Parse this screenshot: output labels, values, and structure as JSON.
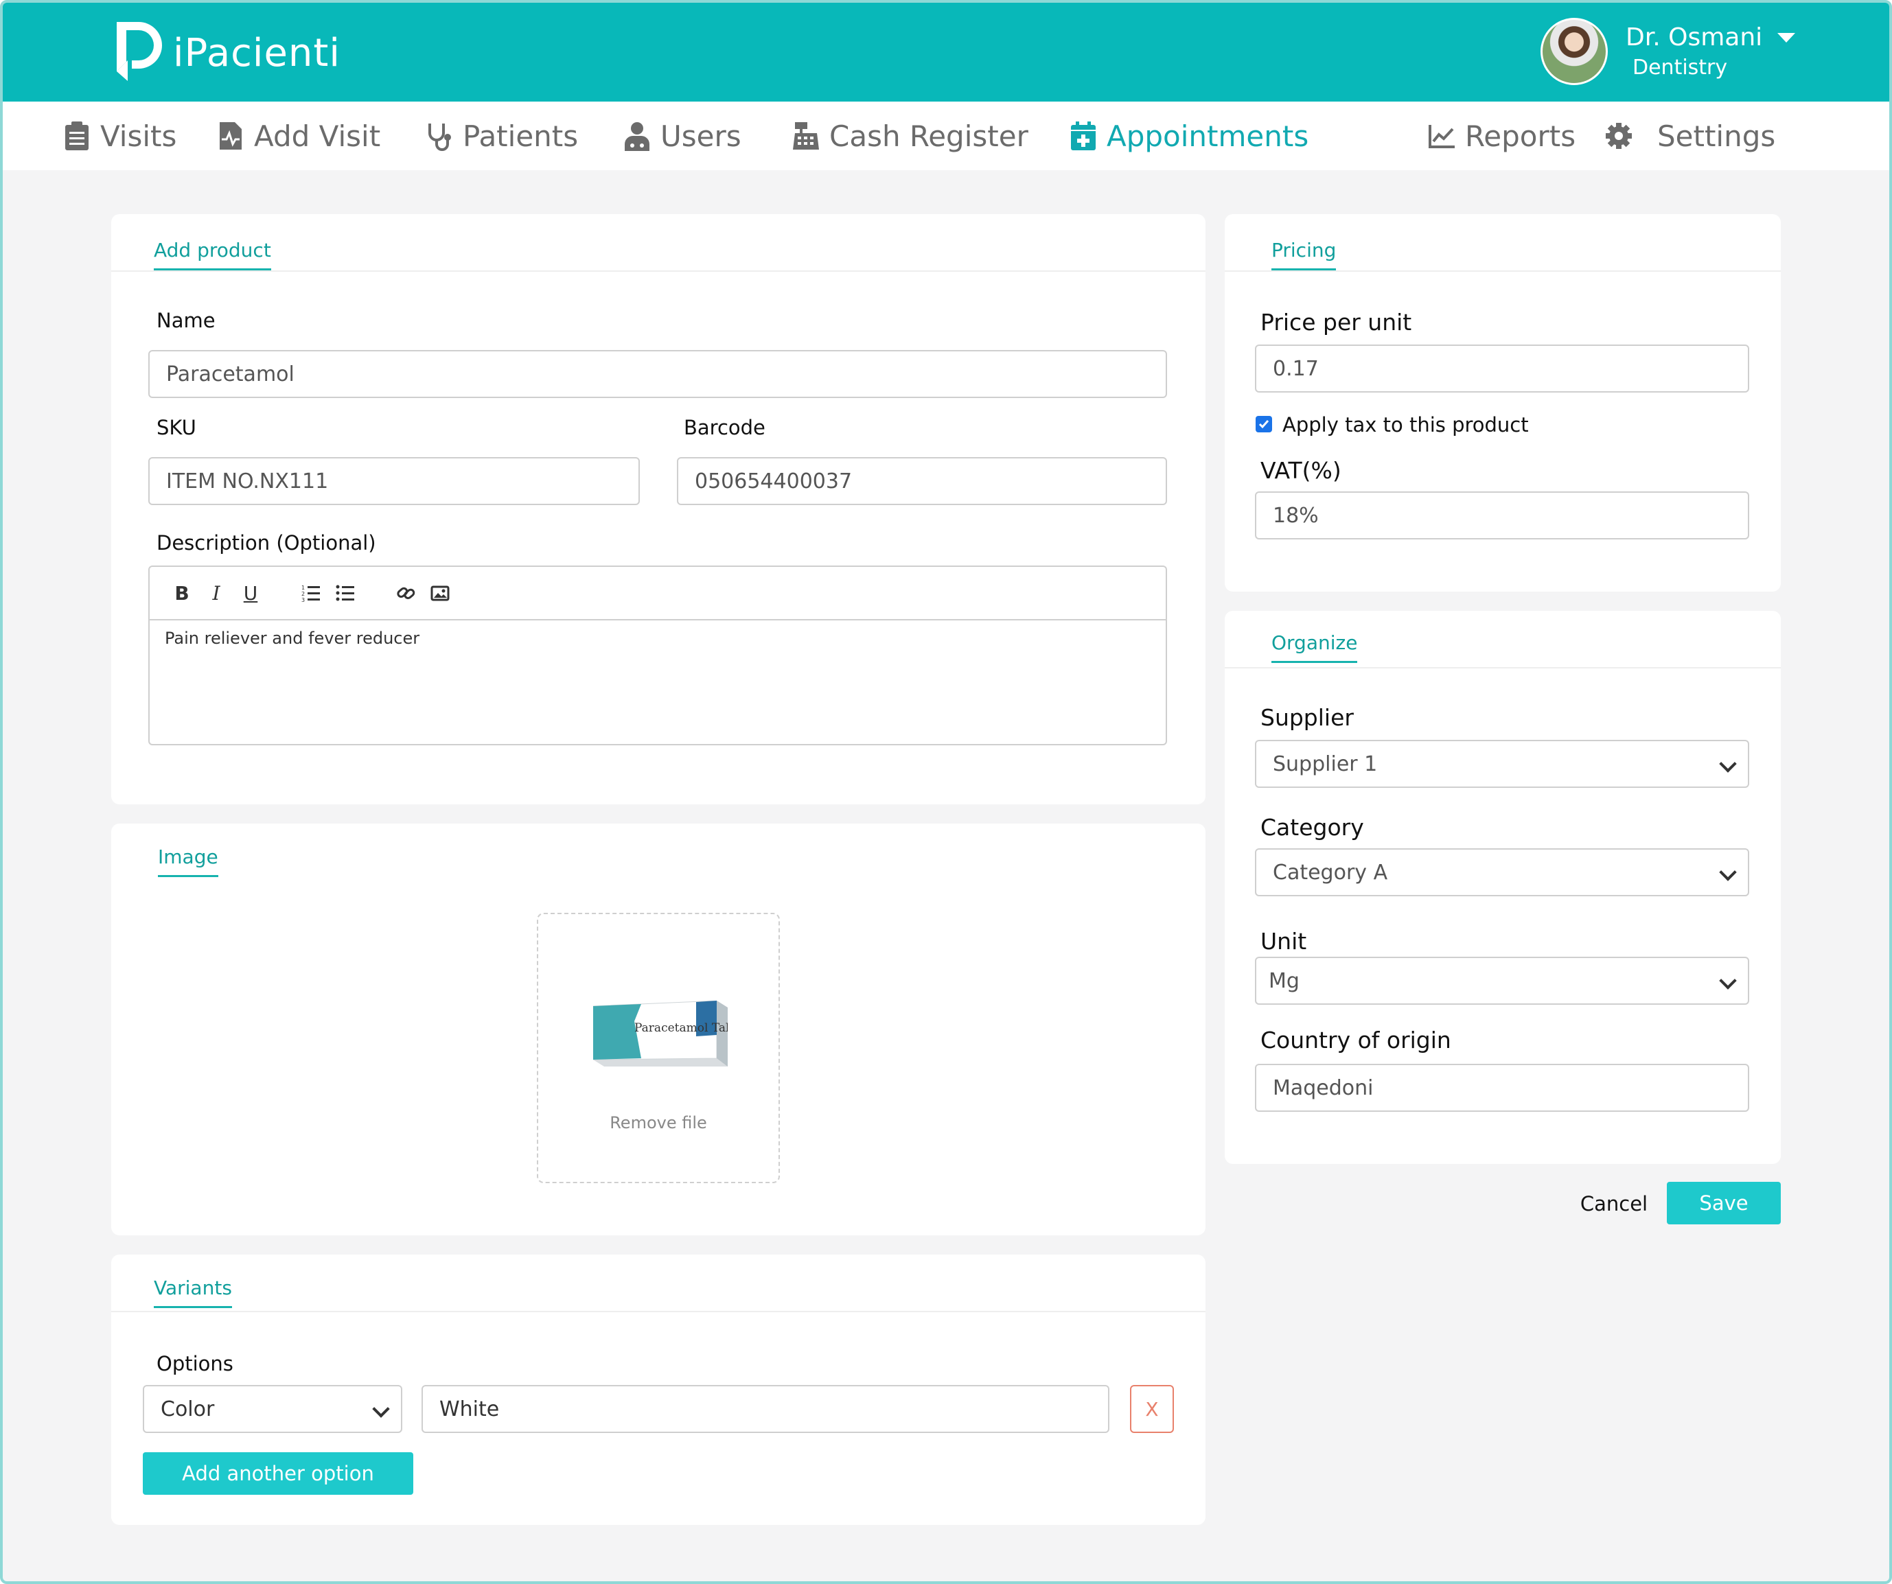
{
  "app": {
    "name": "iPacienti"
  },
  "user": {
    "name": "Dr. Osmani",
    "role": "Dentistry"
  },
  "nav": [
    {
      "label": "Visits",
      "icon": "clipboard-icon"
    },
    {
      "label": "Add Visit",
      "icon": "file-pulse-icon"
    },
    {
      "label": "Patients",
      "icon": "stethoscope-icon"
    },
    {
      "label": "Users",
      "icon": "doctor-icon"
    },
    {
      "label": "Cash Register",
      "icon": "cash-register-icon"
    },
    {
      "label": "Appointments",
      "icon": "calendar-plus-icon",
      "active": true
    },
    {
      "label": "Reports",
      "icon": "chart-line-icon"
    },
    {
      "label": "Settings",
      "icon": "gear-icon"
    }
  ],
  "product": {
    "tab": "Add product",
    "name_label": "Name",
    "name_value": "Paracetamol",
    "sku_label": "SKU",
    "sku_value": "ITEM NO.NX111",
    "barcode_label": "Barcode",
    "barcode_value": "050654400037",
    "description_label": "Description (Optional)",
    "description_value": "Pain reliever and fever reducer",
    "toolbar": [
      "bold",
      "italic",
      "underline",
      "ordered-list",
      "bullet-list",
      "link",
      "image"
    ]
  },
  "image": {
    "tab": "Image",
    "remove_label": "Remove file",
    "package_text": "Paracetamol Tablets"
  },
  "variants": {
    "tab": "Variants",
    "options_label": "Options",
    "option_name": "Color",
    "option_value": "White",
    "remove_label": "X",
    "add_label": "Add another option"
  },
  "pricing": {
    "tab": "Pricing",
    "price_label": "Price per unit",
    "price_value": "0.17",
    "tax_label": "Apply tax to this product",
    "tax_checked": true,
    "vat_label": "VAT(%)",
    "vat_value": "18%"
  },
  "organize": {
    "tab": "Organize",
    "supplier_label": "Supplier",
    "supplier_value": "Supplier 1",
    "category_label": "Category",
    "category_value": "Category A",
    "unit_label": "Unit",
    "unit_value": "Mg",
    "country_label": "Country of origin",
    "country_value": "Maqedoni"
  },
  "actions": {
    "cancel": "Cancel",
    "save": "Save"
  },
  "colors": {
    "accent": "#08b8b9",
    "button": "#1ec9cc",
    "tab_text": "#119f9c",
    "danger": "#e8816c"
  }
}
